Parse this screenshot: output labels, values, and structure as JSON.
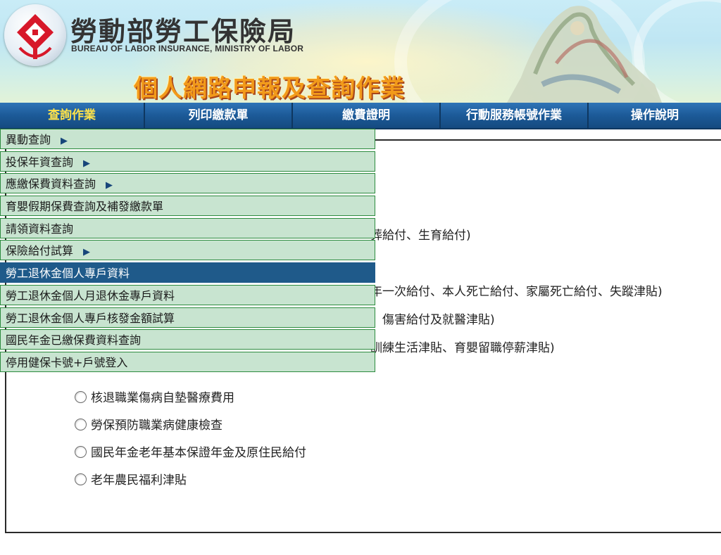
{
  "header": {
    "org_name": "勞動部勞工保險局",
    "org_name_en": "BUREAU OF LABOR INSURANCE, MINISTRY OF LABOR",
    "app_title": "個人網路申報及查詢作業"
  },
  "topnav": {
    "items": [
      "查詢作業",
      "列印繳款單",
      "繳費證明",
      "行動服務帳號作業",
      "操作說明"
    ],
    "active_index": 0
  },
  "dropdown": {
    "items": [
      {
        "label": "異動查詢",
        "has_submenu": true
      },
      {
        "label": "投保年資查詢",
        "has_submenu": true
      },
      {
        "label": "應繳保費資料查詢",
        "has_submenu": true
      },
      {
        "label": "育嬰假期保費查詢及補發繳款單",
        "has_submenu": false
      },
      {
        "label": "請領資料查詢",
        "has_submenu": false
      },
      {
        "label": "保險給付試算",
        "has_submenu": true
      },
      {
        "label": "勞工退休金個人專戶資料",
        "has_submenu": false
      },
      {
        "label": "勞工退休金個人月退休金專戶資料",
        "has_submenu": false
      },
      {
        "label": "勞工退休金個人專戶核發金額試算",
        "has_submenu": false
      },
      {
        "label": "國民年金已繳保費資料查詢",
        "has_submenu": false
      },
      {
        "label": "停用健保卡號+戶號登入",
        "has_submenu": false
      }
    ],
    "selected_index": 6,
    "submenu_arrow": "▶"
  },
  "content": {
    "partial_lines": [
      "葬給付、生育給付)",
      "年一次給付、本人死亡給付、家屬死亡給付、失蹤津貼)",
      "、傷害給付及就醫津貼)",
      "訓練生活津貼、育嬰留職停薪津貼)"
    ],
    "radio_options": [
      "核退職業傷病自墊醫療費用",
      "勞保預防職業病健康檢查",
      "國民年金老年基本保證年金及原住民給付",
      "老年農民福利津貼"
    ]
  },
  "colors": {
    "nav_bg": "#1c5a98",
    "nav_active_text": "#ffe34a",
    "menu_bg": "#c8e4d0",
    "menu_border": "#2d8b3f",
    "menu_selected_bg": "#1f5a8a",
    "title_orange": "#f29a1a"
  },
  "icons": {
    "logo": "bli-logo-icon",
    "submenu": "submenu-arrow-icon",
    "radio": "radio-button-icon"
  }
}
